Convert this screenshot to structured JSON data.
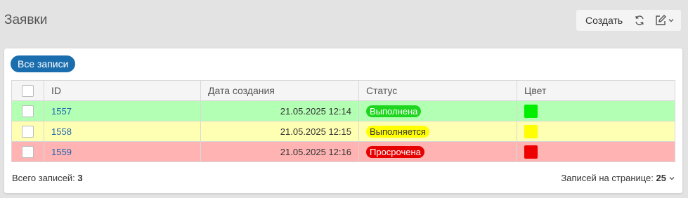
{
  "header": {
    "title": "Заявки"
  },
  "toolbar": {
    "create_label": "Создать",
    "refresh_icon": "refresh-icon",
    "edit_icon": "edit-icon"
  },
  "filter": {
    "all_records_label": "Все записи"
  },
  "table": {
    "columns": [
      "ID",
      "Дата создания",
      "Статус",
      "Цвет"
    ],
    "rows": [
      {
        "id": "1557",
        "date": "21.05.2025 12:14",
        "status": "Выполнена",
        "row_bg": "#b3ffb3",
        "badge_bg": "#1fd61f",
        "badge_fg": "#ffffff",
        "color": "#00ee00"
      },
      {
        "id": "1558",
        "date": "21.05.2025 12:15",
        "status": "Выполняется",
        "row_bg": "#ffffb3",
        "badge_bg": "#ffff00",
        "badge_fg": "#333333",
        "color": "#ffff00"
      },
      {
        "id": "1559",
        "date": "21.05.2025 12:16",
        "status": "Просрочена",
        "row_bg": "#ffb3b3",
        "badge_bg": "#e60000",
        "badge_fg": "#ffffff",
        "color": "#ee0000"
      }
    ]
  },
  "footer": {
    "total_label": "Всего записей:",
    "total_value": "3",
    "per_page_label": "Записей на странице:",
    "per_page_value": "25"
  }
}
